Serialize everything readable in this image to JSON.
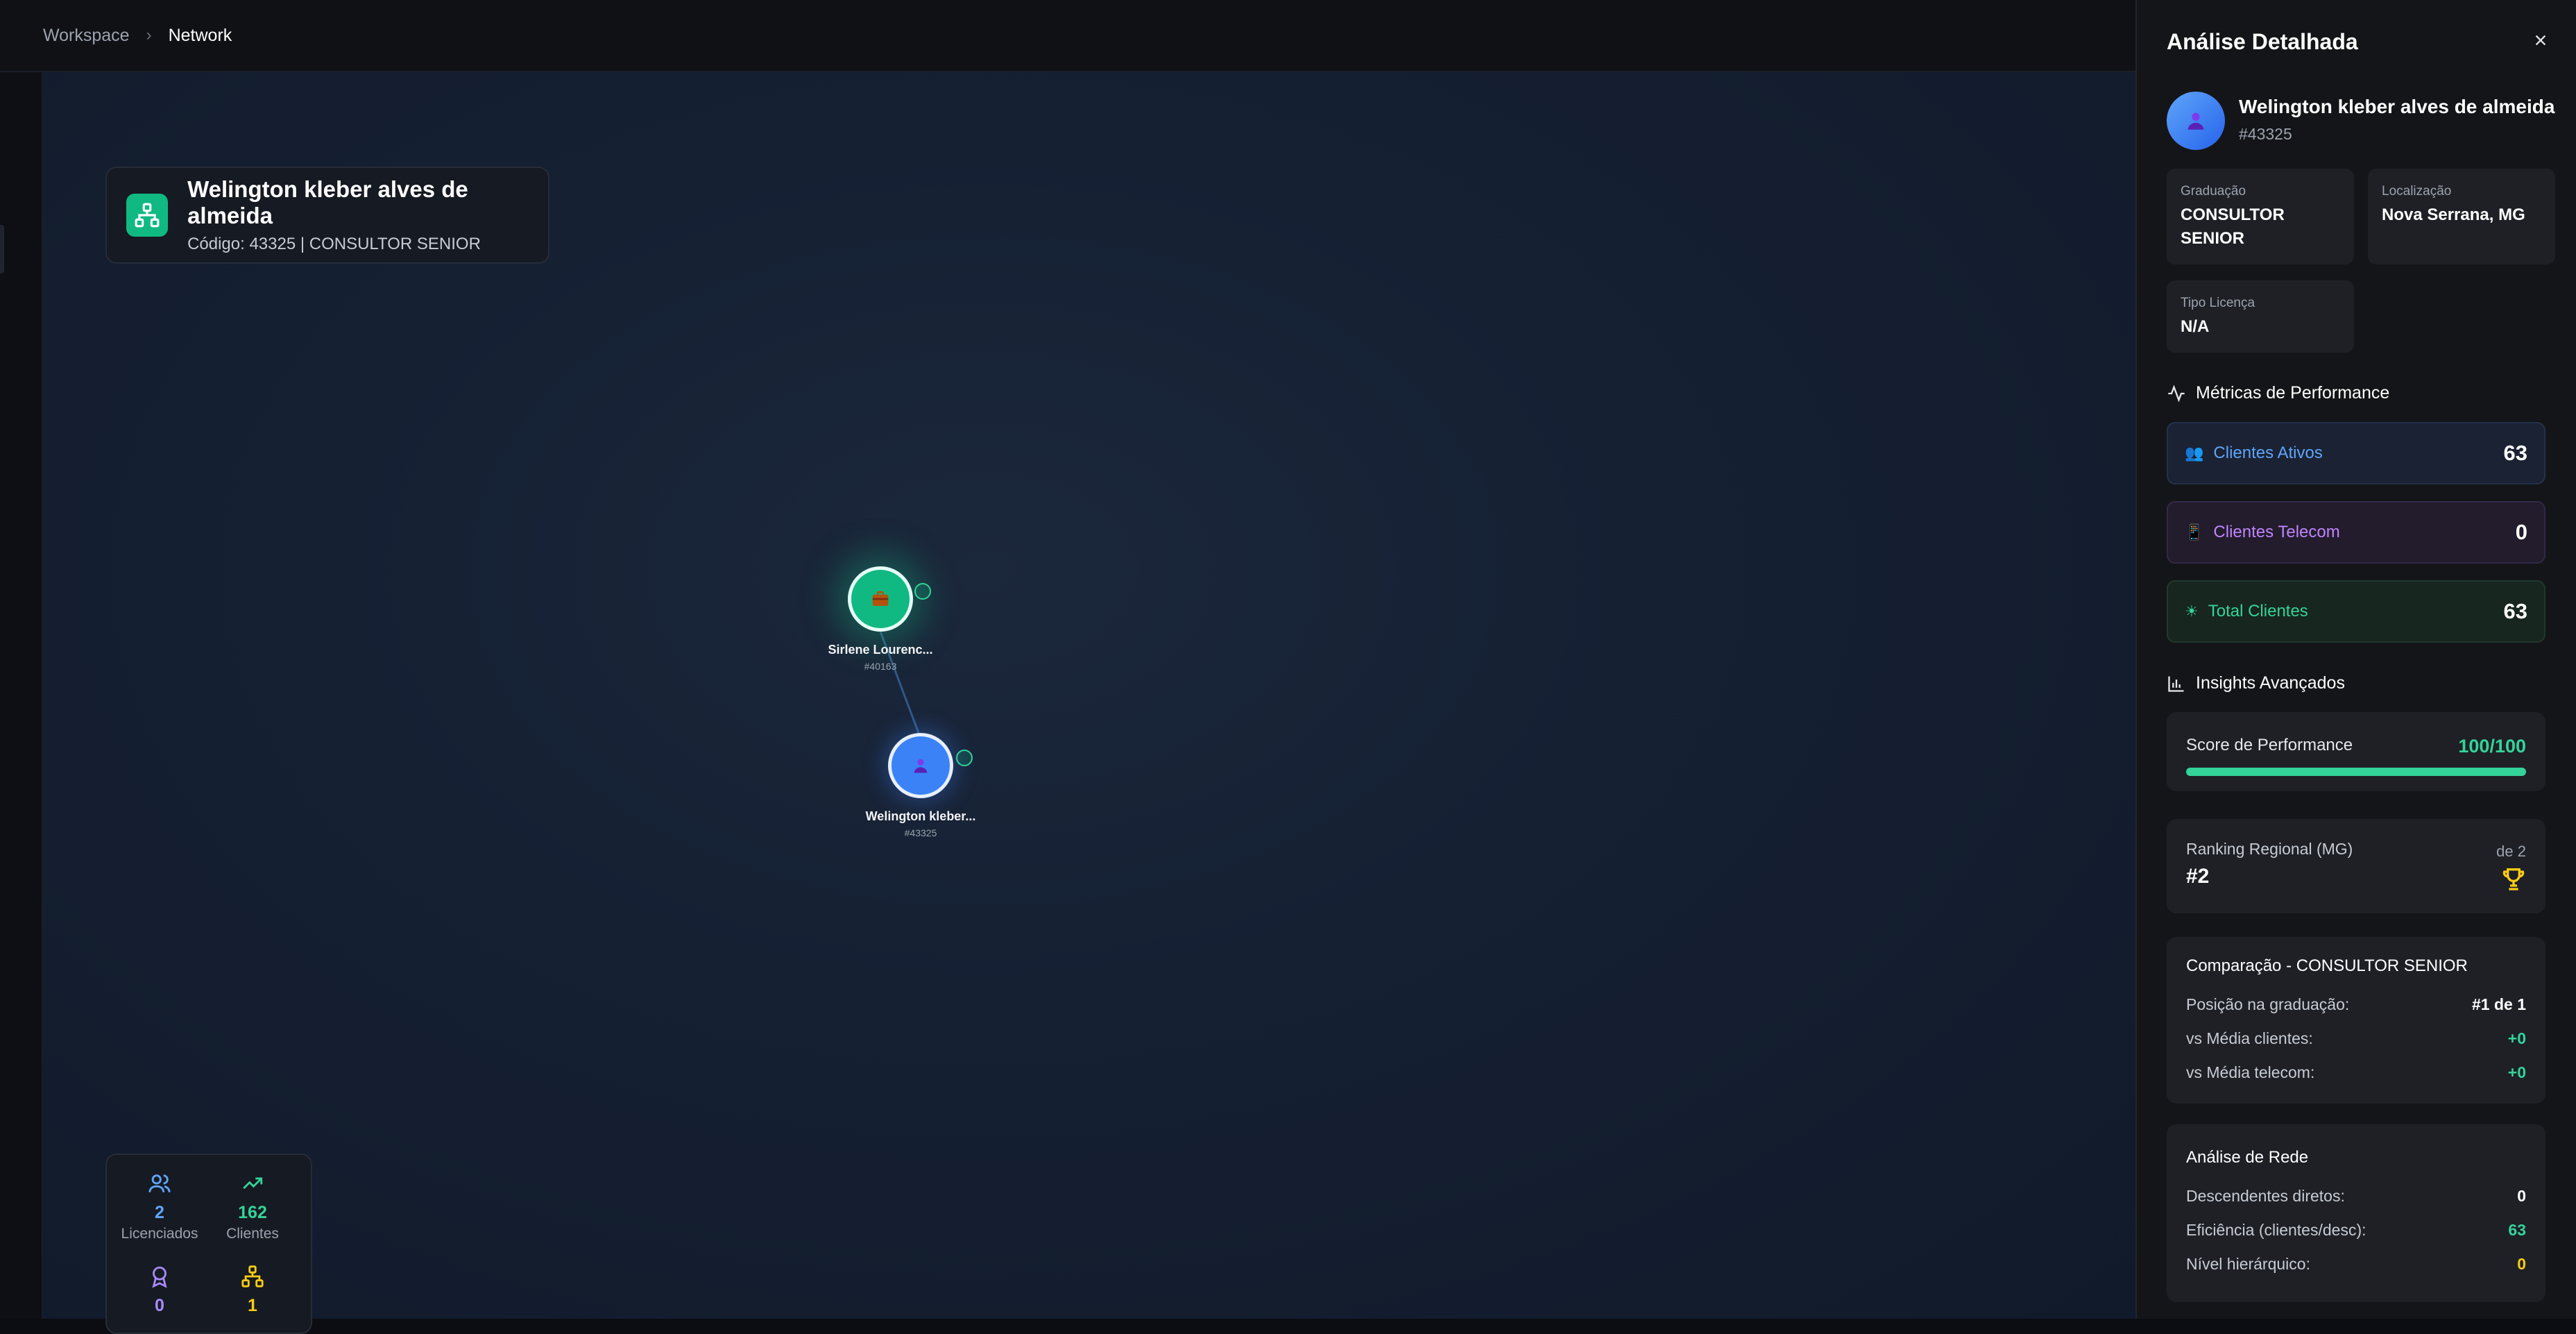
{
  "breadcrumb": {
    "parent": "Workspace",
    "current": "Network"
  },
  "title_card": {
    "name": "Welington kleber alves de almeida",
    "subtitle": "Código: 43325 | CONSULTOR SENIOR"
  },
  "nodes": [
    {
      "name": "Sirlene Lourenc...",
      "code": "#40163",
      "color": "#10b981",
      "icon": "briefcase-icon"
    },
    {
      "name": "Welington kleber...",
      "code": "#43325",
      "color": "#3b82f6",
      "icon": "user-icon"
    }
  ],
  "stats": {
    "licenciados": {
      "value": "2",
      "label": "Licenciados",
      "color": "#60a5fa"
    },
    "clientes": {
      "value": "162",
      "label": "Clientes",
      "color": "#34d399"
    },
    "awards": {
      "value": "0",
      "color": "#a78bfa"
    },
    "network": {
      "value": "1",
      "color": "#facc15"
    }
  },
  "panel": {
    "title": "Análise Detalhada",
    "name": "Welington kleber alves de almeida",
    "code": "#43325",
    "info": {
      "graduacao_label": "Graduação",
      "graduacao_value": "CONSULTOR SENIOR",
      "localizacao_label": "Localização",
      "localizacao_value": "Nova Serrana, MG",
      "licenca_label": "Tipo Licença",
      "licenca_value": "N/A"
    },
    "metrics_title": "Métricas de Performance",
    "metrics": [
      {
        "label": "Clientes Ativos",
        "value": "63",
        "color": "#60a5fa"
      },
      {
        "label": "Clientes Telecom",
        "value": "0",
        "color": "#c084fc"
      },
      {
        "label": "Total Clientes",
        "value": "63",
        "color": "#34d399"
      }
    ],
    "insights_title": "Insights Avançados",
    "score": {
      "label": "Score de Performance",
      "value": "100/100",
      "percent": 100
    },
    "ranking": {
      "label": "Ranking Regional (MG)",
      "value": "#2",
      "of": "de 2"
    },
    "comparacao": {
      "title": "Comparação - CONSULTOR SENIOR",
      "rows": [
        {
          "label": "Posição na graduação:",
          "value": "#1 de 1"
        },
        {
          "label": "vs Média clientes:",
          "value": "+0"
        },
        {
          "label": "vs Média telecom:",
          "value": "+0"
        }
      ]
    },
    "rede": {
      "title": "Análise de Rede",
      "rows": [
        {
          "label": "Descendentes diretos:",
          "value": "0"
        },
        {
          "label": "Eficiência (clientes/desc):",
          "value": "63"
        },
        {
          "label": "Nível hierárquico:",
          "value": "0"
        }
      ]
    }
  }
}
